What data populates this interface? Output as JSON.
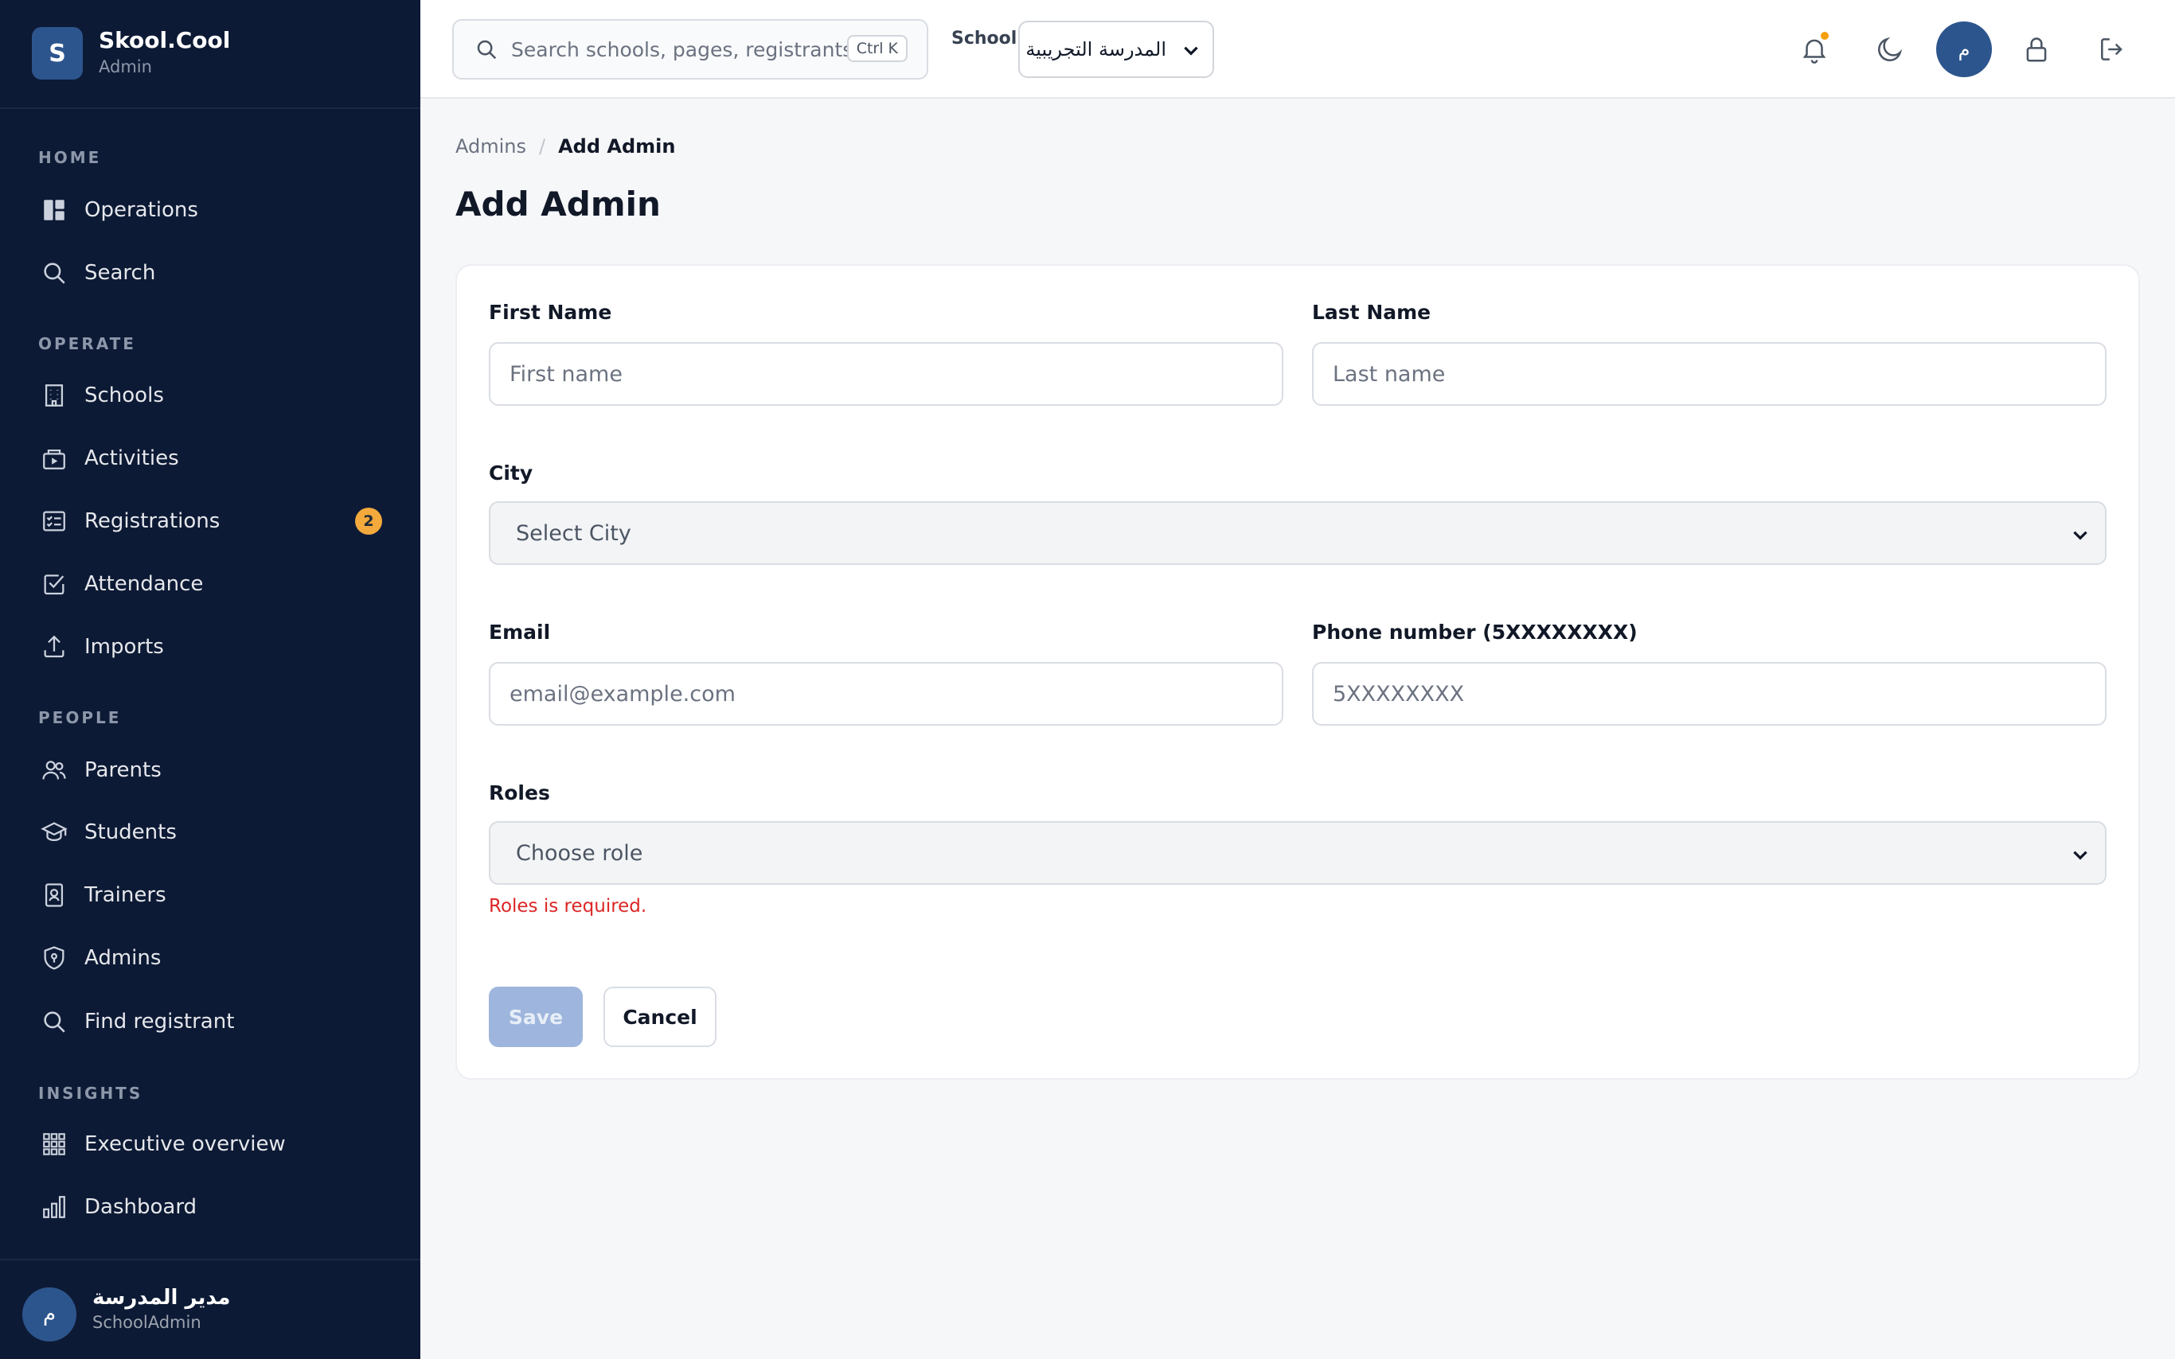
{
  "brand": {
    "logo_letter": "S",
    "name": "Skool.Cool",
    "subtitle": "Admin"
  },
  "sidebar": {
    "sections": [
      {
        "label": "HOME"
      },
      {
        "label": "OPERATE"
      },
      {
        "label": "PEOPLE"
      },
      {
        "label": "INSIGHTS"
      }
    ],
    "items": [
      {
        "label": "Operations",
        "icon": "dashboard-grid-icon"
      },
      {
        "label": "Search",
        "icon": "search-icon"
      },
      {
        "label": "Schools",
        "icon": "building-icon"
      },
      {
        "label": "Activities",
        "icon": "activities-icon"
      },
      {
        "label": "Registrations",
        "icon": "registrations-icon",
        "badge": "2"
      },
      {
        "label": "Attendance",
        "icon": "checkbox-icon"
      },
      {
        "label": "Imports",
        "icon": "upload-icon"
      },
      {
        "label": "Parents",
        "icon": "users-icon"
      },
      {
        "label": "Students",
        "icon": "graduation-cap-icon"
      },
      {
        "label": "Trainers",
        "icon": "id-badge-icon"
      },
      {
        "label": "Admins",
        "icon": "shield-icon"
      },
      {
        "label": "Find registrant",
        "icon": "search-icon"
      },
      {
        "label": "Executive overview",
        "icon": "apps-grid-icon"
      },
      {
        "label": "Dashboard",
        "icon": "bar-chart-icon"
      }
    ],
    "user": {
      "avatar_letter": "م",
      "name": "مدير المدرسة",
      "role": "SchoolAdmin"
    }
  },
  "topbar": {
    "search_placeholder": "Search schools, pages, registrants...",
    "search_shortcut": "Ctrl K",
    "school_label": "School",
    "school_value": "المدرسة التجريبية",
    "avatar_letter": "م"
  },
  "breadcrumb": {
    "parent": "Admins",
    "separator": "/",
    "current": "Add Admin"
  },
  "page_title": "Add Admin",
  "form": {
    "first_name": {
      "label": "First Name",
      "placeholder": "First name",
      "value": ""
    },
    "last_name": {
      "label": "Last Name",
      "placeholder": "Last name",
      "value": ""
    },
    "city": {
      "label": "City",
      "selected": "Select City"
    },
    "email": {
      "label": "Email",
      "placeholder": "email@example.com",
      "value": ""
    },
    "phone": {
      "label": "Phone number (5XXXXXXXX)",
      "placeholder": "5XXXXXXXX",
      "value": ""
    },
    "roles": {
      "label": "Roles",
      "selected": "Choose role",
      "error": "Roles is required."
    },
    "save_label": "Save",
    "cancel_label": "Cancel"
  },
  "colors": {
    "sidebar_bg": "#0d1a35",
    "accent": "#2d558d",
    "badge": "#f3a93c",
    "error": "#dc2626",
    "save_disabled": "#9eb6dd"
  }
}
